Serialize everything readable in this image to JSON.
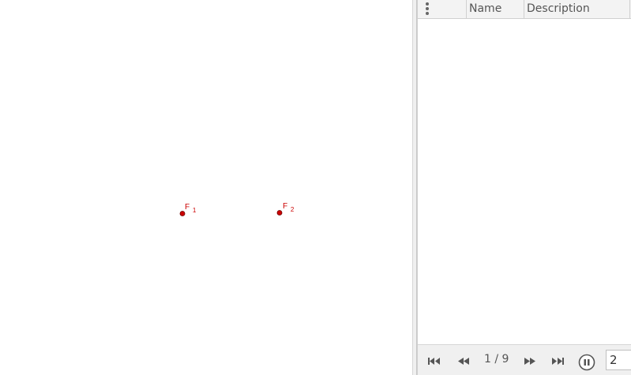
{
  "graphics": {
    "points": [
      {
        "name": "F",
        "subscript": "1",
        "color": "#cc0000"
      },
      {
        "name": "F",
        "subscript": "2",
        "color": "#cc0000"
      }
    ]
  },
  "protocol": {
    "columns": {
      "menu_icon": "kebab-menu-icon",
      "name": "Name",
      "description": "Description"
    },
    "rows": []
  },
  "navigation": {
    "step_text": "1 / 9",
    "speed_value": "2",
    "icons": [
      "skip-to-start-icon",
      "step-back-icon",
      "step-forward-icon",
      "skip-to-end-icon",
      "pause-icon"
    ]
  },
  "colors": {
    "point": "#cc0000",
    "icon": "#555555"
  }
}
